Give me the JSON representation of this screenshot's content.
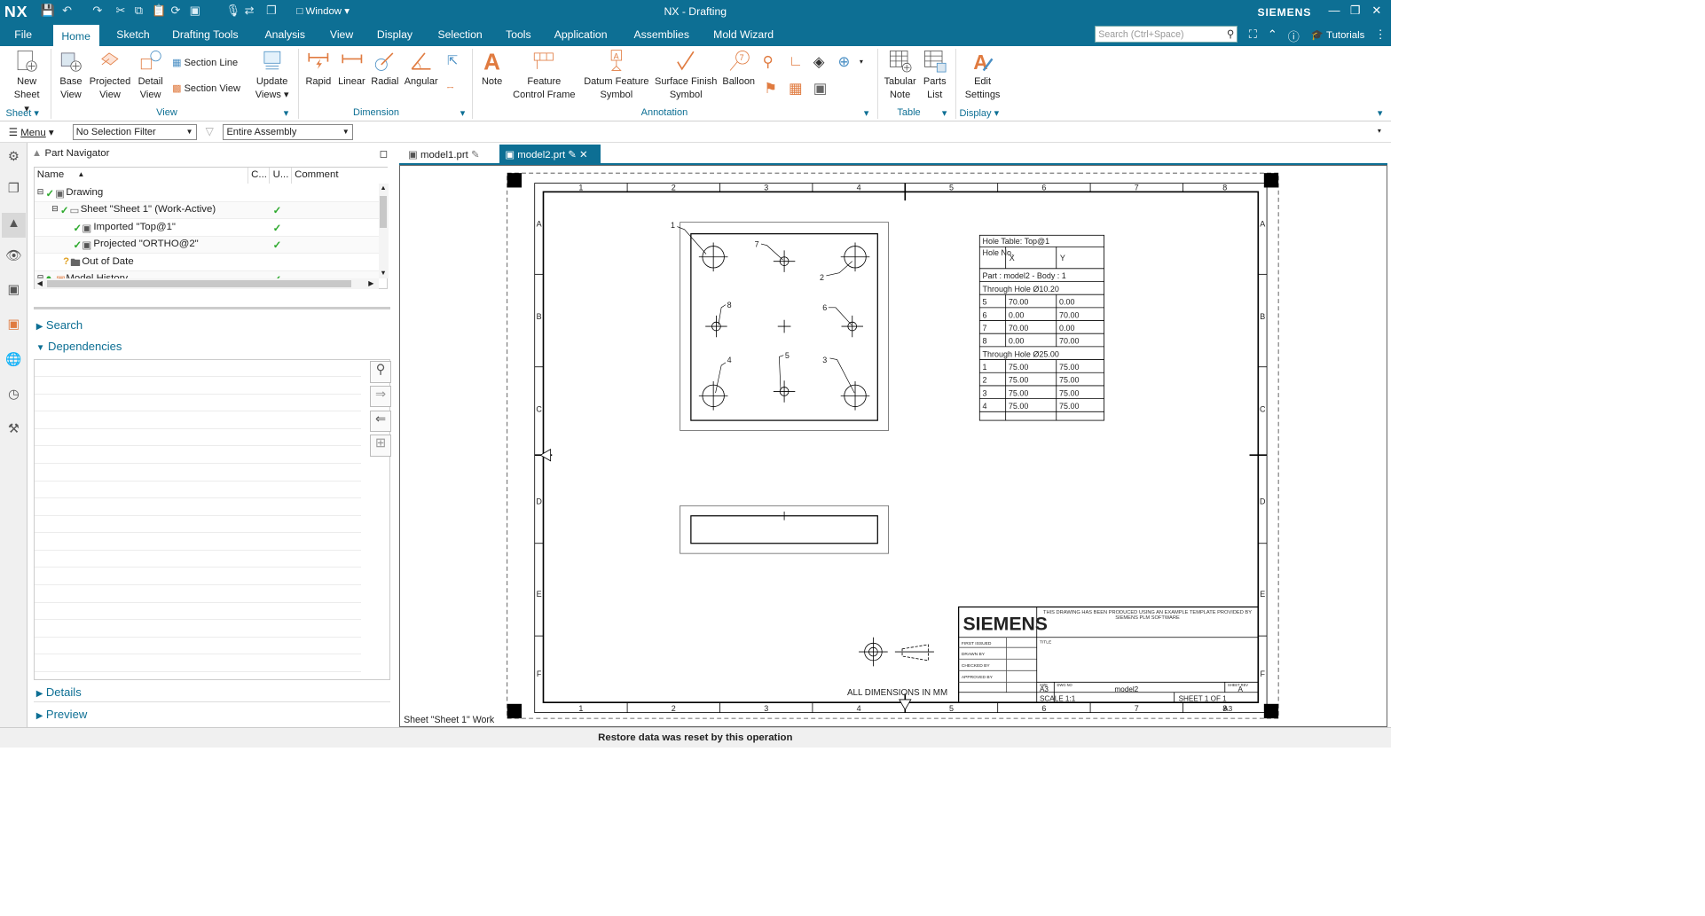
{
  "app": {
    "logo": "NX",
    "title": "NX - Drafting",
    "brand": "SIEMENS",
    "window_menu": "Window"
  },
  "menu_tabs": [
    "File",
    "Home",
    "Sketch",
    "Drafting Tools",
    "Analysis",
    "View",
    "Display",
    "Selection",
    "Tools",
    "Application",
    "Assemblies",
    "Mold Wizard"
  ],
  "search": {
    "placeholder": "Search (Ctrl+Space)"
  },
  "tutorials": "Tutorials",
  "ribbon": {
    "new_sheet": [
      "New",
      "Sheet"
    ],
    "base_view": [
      "Base",
      "View"
    ],
    "projected_view": [
      "Projected",
      "View"
    ],
    "detail_view": [
      "Detail",
      "View"
    ],
    "section_line": "Section Line",
    "section_view": "Section View",
    "update_views": [
      "Update",
      "Views"
    ],
    "rapid": "Rapid",
    "linear": "Linear",
    "radial": "Radial",
    "angular": "Angular",
    "note": "Note",
    "feature_control_frame": [
      "Feature",
      "Control Frame"
    ],
    "datum_feature_symbol": [
      "Datum Feature",
      "Symbol"
    ],
    "surface_finish_symbol": [
      "Surface Finish",
      "Symbol"
    ],
    "balloon": "Balloon",
    "tabular_note": [
      "Tabular",
      "Note"
    ],
    "parts_list": [
      "Parts",
      "List"
    ],
    "edit_settings": [
      "Edit",
      "Settings"
    ],
    "groups": {
      "sheet": "Sheet",
      "view": "View",
      "dimension": "Dimension",
      "annotation": "Annotation",
      "table": "Table",
      "display": "Display"
    }
  },
  "toolbar2": {
    "menu": "Menu",
    "selection_filter": "No Selection Filter",
    "scope": "Entire Assembly"
  },
  "part_navigator": {
    "title": "Part Navigator",
    "columns": [
      "Name",
      "C...",
      "U...",
      "Comment"
    ],
    "rows": [
      {
        "name": "Drawing",
        "updated": false
      },
      {
        "name": "Sheet \"Sheet 1\" (Work-Active)",
        "updated": true
      },
      {
        "name": "Imported \"Top@1\"",
        "updated": true
      },
      {
        "name": "Projected \"ORTHO@2\"",
        "updated": true
      },
      {
        "name": "Out of Date",
        "updated": false
      },
      {
        "name": "Model History",
        "updated": true
      }
    ],
    "sections": {
      "search": "Search",
      "dependencies": "Dependencies",
      "details": "Details",
      "preview": "Preview"
    }
  },
  "doc_tabs": [
    "model1.prt",
    "model2.prt"
  ],
  "drawing": {
    "col_numbers": [
      "1",
      "2",
      "3",
      "4",
      "5",
      "6",
      "7",
      "8"
    ],
    "row_letters": [
      "A",
      "B",
      "C",
      "D",
      "E",
      "F"
    ],
    "hole_labels": [
      "1",
      "2",
      "3",
      "4",
      "5",
      "6",
      "7",
      "8"
    ],
    "hole_table": {
      "title": "Hole Table: Top@1",
      "headers": [
        "Hole No.",
        "X",
        "Y"
      ],
      "part_row": "Part : model2 - Body : 1",
      "groups": [
        {
          "label": "Through Hole Ø10.20",
          "rows": [
            [
              "5",
              "70.00",
              "0.00"
            ],
            [
              "6",
              "0.00",
              "70.00"
            ],
            [
              "7",
              "70.00",
              "0.00"
            ],
            [
              "8",
              "0.00",
              "70.00"
            ]
          ]
        },
        {
          "label": "Through Hole Ø25.00",
          "rows": [
            [
              "1",
              "75.00",
              "75.00"
            ],
            [
              "2",
              "75.00",
              "75.00"
            ],
            [
              "3",
              "75.00",
              "75.00"
            ],
            [
              "4",
              "75.00",
              "75.00"
            ]
          ]
        }
      ]
    },
    "title_block": {
      "logo": "SIEMENS",
      "note": "THIS DRAWING HAS BEEN PRODUCED USING AN EXAMPLE TEMPLATE PROVIDED BY SIEMENS PLM SOFTWARE",
      "fields": [
        "FIRST ISSUED",
        "DRAWN BY",
        "CHECKED BY",
        "APPROVED BY"
      ],
      "title_label": "TITLE",
      "size_label": "SIZE",
      "size": "A3",
      "dwg_label": "DWG NO",
      "dwg_no": "model2",
      "sheet_rev_label": "SHEET REV",
      "rev": "A",
      "scale": "SCALE 1:1",
      "sheet": "SHEET 1 OF 1",
      "sheet_size": "A3"
    },
    "all_dims": "ALL DIMENSIONS IN MM",
    "sheet_label": "Sheet \"Sheet 1\" Work"
  },
  "status": "Restore data was reset by this operation"
}
